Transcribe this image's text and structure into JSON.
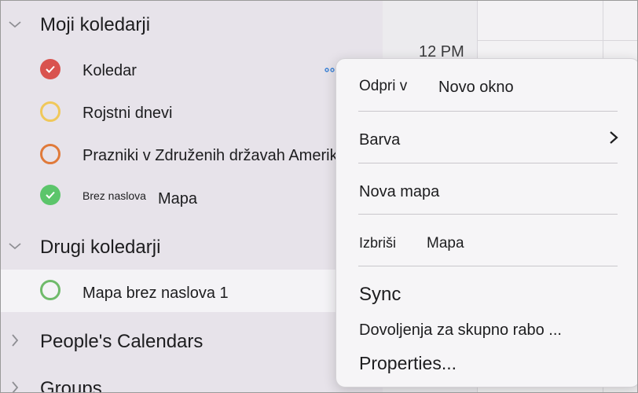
{
  "calendar": {
    "time_label": "12 PM"
  },
  "sections": {
    "my_calendars": {
      "title": "Moji koledarji",
      "items": [
        {
          "label": "Koledar",
          "color": "#d9534f",
          "checked": true
        },
        {
          "label": "Rojstni dnevi",
          "color": "#f0c85a",
          "checked": false
        },
        {
          "label": "Prazniki v Združenih državah Amerike",
          "color": "#e07a3a",
          "checked": false
        },
        {
          "label_small": "Brez naslova",
          "label_main": "Mapa",
          "color": "#5cc56b",
          "checked": true
        }
      ]
    },
    "other_calendars": {
      "title": "Drugi koledarji",
      "items": [
        {
          "label": "Mapa brez naslova 1",
          "color": "#6fba6a",
          "checked": false
        }
      ]
    },
    "peoples_calendars": {
      "title": "People's Calendars"
    },
    "groups": {
      "title": "Groups"
    }
  },
  "context_menu": {
    "open_in_prefix": "Odpri v",
    "open_in_value": "Novo okno",
    "color": "Barva",
    "new_folder": "Nova mapa",
    "delete_prefix": "Izbriši",
    "delete_value": "Mapa",
    "sync": "Sync",
    "sharing_permissions": "Dovoljenja za skupno rabo ...",
    "properties": "Properties..."
  }
}
